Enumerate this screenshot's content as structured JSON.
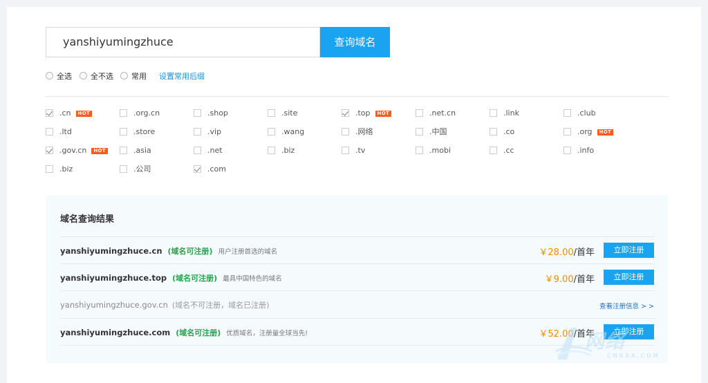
{
  "search": {
    "value": "yanshiyumingzhuce",
    "button_label": "查询域名"
  },
  "options": {
    "select_all": "全选",
    "select_none": "全不选",
    "common": "常用",
    "set_common": "设置常用后缀"
  },
  "tlds": [
    {
      "label": ".cn",
      "checked": true,
      "hot": true
    },
    {
      "label": ".org.cn",
      "checked": false,
      "hot": false
    },
    {
      "label": ".shop",
      "checked": false,
      "hot": false
    },
    {
      "label": ".site",
      "checked": false,
      "hot": false
    },
    {
      "label": ".top",
      "checked": true,
      "hot": true
    },
    {
      "label": ".net.cn",
      "checked": false,
      "hot": false
    },
    {
      "label": ".link",
      "checked": false,
      "hot": false
    },
    {
      "label": ".club",
      "checked": false,
      "hot": false
    },
    {
      "label": ".ltd",
      "checked": false,
      "hot": false
    },
    {
      "label": ".store",
      "checked": false,
      "hot": false
    },
    {
      "label": ".vip",
      "checked": false,
      "hot": false
    },
    {
      "label": ".wang",
      "checked": false,
      "hot": false
    },
    {
      "label": ".网络",
      "checked": false,
      "hot": false
    },
    {
      "label": ".中国",
      "checked": false,
      "hot": false
    },
    {
      "label": ".co",
      "checked": false,
      "hot": false
    },
    {
      "label": ".org",
      "checked": false,
      "hot": true
    },
    {
      "label": ".gov.cn",
      "checked": true,
      "hot": true
    },
    {
      "label": ".asia",
      "checked": false,
      "hot": false
    },
    {
      "label": ".net",
      "checked": false,
      "hot": false
    },
    {
      "label": ".biz",
      "checked": false,
      "hot": false
    },
    {
      "label": ".tv",
      "checked": false,
      "hot": false
    },
    {
      "label": ".mobi",
      "checked": false,
      "hot": false
    },
    {
      "label": ".cc",
      "checked": false,
      "hot": false
    },
    {
      "label": ".info",
      "checked": false,
      "hot": false
    },
    {
      "label": ".biz",
      "checked": false,
      "hot": false
    },
    {
      "label": ".公司",
      "checked": false,
      "hot": false
    },
    {
      "label": ".com",
      "checked": true,
      "hot": false
    }
  ],
  "hot_label": "HOT",
  "results": {
    "title": "域名查询结果",
    "rows": [
      {
        "domain": "yanshiyumingzhuce.cn",
        "status": "(域名可注册)",
        "desc": "用户注册首选的域名",
        "price": "￥28.00",
        "unit": "/首年",
        "button": "立即注册",
        "available": true
      },
      {
        "domain": "yanshiyumingzhuce.top",
        "status": "(域名可注册)",
        "desc": "最具中国特色的域名",
        "price": "￥9.00",
        "unit": "/首年",
        "button": "立即注册",
        "available": true
      },
      {
        "domain": "yanshiyumingzhuce.gov.cn",
        "status": "(域名不可注册，域名已注册)",
        "desc": "",
        "link": "查看注册信息 > >",
        "available": false
      },
      {
        "domain": "yanshiyumingzhuce.com",
        "status": "(域名可注册)",
        "desc": "优质域名，注册量全球当先!",
        "price": "￥52.00",
        "unit": "/首年",
        "button": "立即注册",
        "available": true
      }
    ]
  },
  "watermark": {
    "text": "网络",
    "sub": "CNAAA.COM"
  }
}
